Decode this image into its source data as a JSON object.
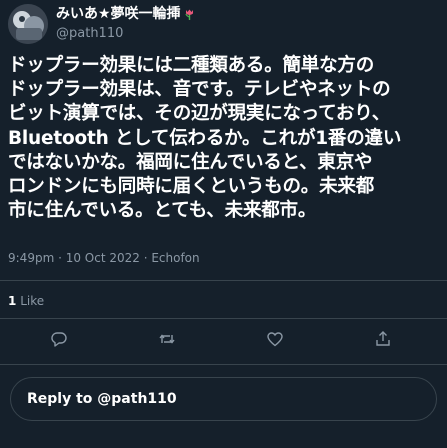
{
  "tweet": {
    "display_name": "みいあ★夢咲一輪挿",
    "display_name_emoji_icon": "tulip-icon",
    "handle": "@path110",
    "body": "ドップラー効果には二種類ある。簡単な方の\nドップラー効果は、音です。テレビやネットの\nビット演算では、その辺が現実になっており、\nBluetooth として伝わるか。これが1番の違い\nではないかな。福岡に住んでいると、東京や\nロンドンにも同時に届くというもの。未来都\n市に住んでいる。とても、未来都市。",
    "timestamp": "9:49pm · 10 Oct 2022 · Echofon",
    "likes_count": "1",
    "likes_label": "Like"
  },
  "actions": {
    "reply_icon": "comment-bubble-icon",
    "retweet_icon": "retweet-icon",
    "like_icon": "heart-icon",
    "share_icon": "share-icon"
  },
  "reply_box": {
    "label": "Reply to @path110"
  },
  "colors": {
    "background": "#15202b",
    "text": "#ffffff",
    "secondary_text": "#8b98a5",
    "divider": "#38444d"
  }
}
